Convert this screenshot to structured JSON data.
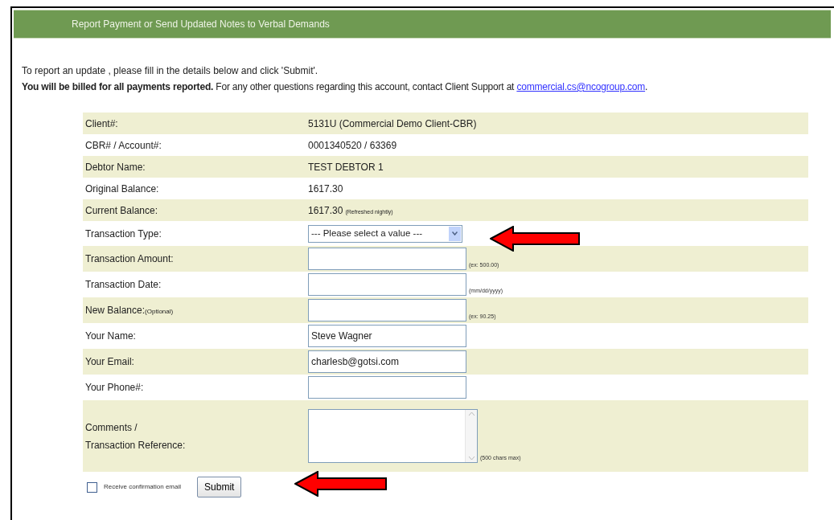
{
  "banner": {
    "title": "Report Payment or Send Updated Notes to Verbal Demands"
  },
  "intro": {
    "line_1": "To report an update , please fill in the details below and click 'Submit'.",
    "line_2_bold": "You will be billed for all payments reported.",
    "line_2": "For any other questions regarding this account, contact Client Support at",
    "email_link": "commercial.cs@ncogroup.com",
    "line_2_end": "."
  },
  "rows": [
    {
      "kind": "text",
      "label": "Client#:",
      "value": "5131U (Commercial Demo Client-CBR)"
    },
    {
      "kind": "text",
      "label": "CBR# / Account#:",
      "value": "0001340520 / 63369"
    },
    {
      "kind": "text",
      "label": "Debtor Name:",
      "value": "TEST DEBTOR 1"
    },
    {
      "kind": "text",
      "label": "Original Balance:",
      "value": "1617.30"
    },
    {
      "kind": "text",
      "label": "Current Balance:",
      "value": "1617.30",
      "note": "(Refreshed nightly)"
    },
    {
      "kind": "select",
      "label": "Transaction Type:",
      "value": "--- Please select a value ---"
    },
    {
      "kind": "input",
      "label": "Transaction Amount:",
      "hint": "(ex: 500.00)"
    },
    {
      "kind": "input",
      "label": "Transaction Date:",
      "hint": "(mm/dd/yyyy)"
    },
    {
      "kind": "input",
      "label": "New Balance:",
      "label_note": "(Optional)",
      "hint": "(ex: 90.25)"
    },
    {
      "kind": "input",
      "label": "Your Name:",
      "value": "Steve Wagner"
    },
    {
      "kind": "input",
      "label": "Your Email:",
      "value": "charlesb@gotsi.com"
    },
    {
      "kind": "input",
      "label": "Your Phone#:"
    },
    {
      "kind": "textarea",
      "label": "Comments / Transaction Reference:",
      "hint": "(500 chars max)"
    }
  ],
  "confirmation": {
    "label": "Receive confirmation email",
    "checked": false
  },
  "submit_button": "Submit"
}
